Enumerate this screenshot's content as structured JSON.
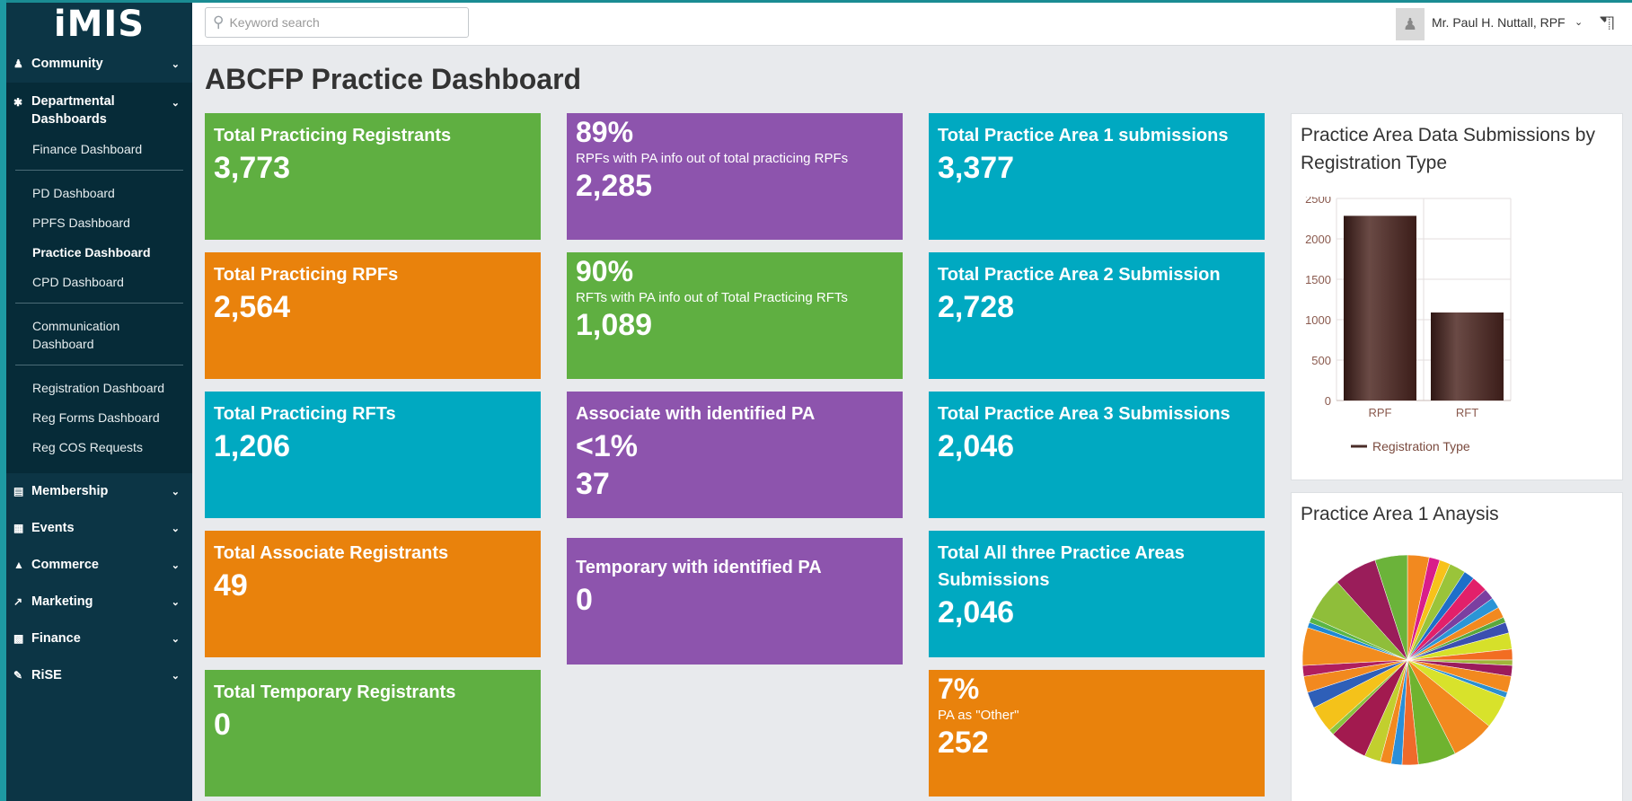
{
  "app": {
    "logo": "iMIS"
  },
  "header": {
    "search_placeholder": "Keyword search",
    "user_name": "Mr. Paul H. Nuttall, RPF",
    "icons": {
      "search": "magnifier-icon",
      "user": "person-icon",
      "cart": "cart-icon"
    }
  },
  "sidebar": {
    "community": "Community",
    "departmental": "Departmental Dashboards",
    "sub_items": [
      "Finance Dashboard",
      "PD Dashboard",
      "PPFS Dashboard",
      "Practice Dashboard",
      "CPD Dashboard",
      "Communication Dashboard",
      "Registration Dashboard",
      "Reg Forms Dashboard",
      "Reg COS Requests"
    ],
    "active_item": "Practice Dashboard",
    "groups": [
      "Membership",
      "Events",
      "Commerce",
      "Marketing",
      "Finance",
      "RiSE"
    ]
  },
  "page": {
    "title": "ABCFP Practice Dashboard"
  },
  "cards": {
    "c1": {
      "title": "Total Practicing Registrants",
      "value": "3,773"
    },
    "c2": {
      "title": "Total Practicing RPFs",
      "value": "2,564"
    },
    "c3": {
      "title": "Total Practicing RFTs",
      "value": "1,206"
    },
    "c4": {
      "title": "Total Associate Registrants",
      "value": "49"
    },
    "c5": {
      "title": "Total Temporary Registrants",
      "value": "0"
    },
    "p1": {
      "pct": "89%",
      "desc": "RPFs with PA info out of total practicing RPFs",
      "value": "2,285"
    },
    "p2": {
      "pct": "90%",
      "desc": "RFTs with PA info out of Total Practicing RFTs",
      "value": "1,089"
    },
    "p3": {
      "title": "Associate with identified PA",
      "pct": "<1%",
      "value": "37"
    },
    "p4": {
      "title": "Temporary with identified PA",
      "value": "0"
    },
    "t1": {
      "title": "Total Practice Area 1 submissions",
      "value": "3,377"
    },
    "t2": {
      "title": "Total Practice Area 2 Submission",
      "value": "2,728"
    },
    "t3": {
      "title": "Total Practice Area 3 Submissions",
      "value": "2,046"
    },
    "t4": {
      "title": "Total All three Practice Areas Submissions",
      "value": "2,046"
    },
    "t5": {
      "pct": "7%",
      "desc": "PA as \"Other\"",
      "value": "252"
    }
  },
  "colors": {
    "green": "#5faf41",
    "orange": "#e9820c",
    "teal": "#00a9c1",
    "purple": "#8d54ad",
    "sidebar": "#0c3545",
    "bar": "#4a2c28"
  },
  "panels": {
    "bar_title": "Practice Area Data Submissions by Registration Type",
    "pie_title": "Practice Area 1 Anaysis"
  },
  "chart_data": [
    {
      "type": "bar",
      "title": "Practice Area Data Submissions by Registration Type",
      "categories": [
        "RPF",
        "RFT"
      ],
      "series": [
        {
          "name": "Registration Type",
          "values": [
            2285,
            1089
          ]
        }
      ],
      "ylim": [
        0,
        2500
      ],
      "yticks": [
        "0",
        "500",
        "1000",
        "1500",
        "2000",
        "2500"
      ],
      "grid": true,
      "legend": "bottom"
    },
    {
      "type": "pie",
      "title": "Practice Area 1 Anaysis",
      "values": [
        4,
        2,
        2,
        3,
        2,
        3,
        2,
        2,
        2,
        1,
        2,
        3,
        2,
        1,
        2,
        3,
        1,
        6,
        8,
        7,
        3,
        2,
        2,
        3,
        7,
        1,
        5,
        3,
        3,
        2,
        7,
        1,
        1,
        8,
        8,
        6
      ],
      "colors": [
        "#f2891f",
        "#d91d8a",
        "#f7c21a",
        "#9ac43a",
        "#1e6fc9",
        "#e2206a",
        "#7b3fa0",
        "#2b95d6",
        "#f2891f",
        "#5aa83c",
        "#3a4fb0",
        "#d6e02a",
        "#f26d22",
        "#a0b53a",
        "#9b1b5c",
        "#f2891f",
        "#2c8fd0",
        "#d8e22b",
        "#f2891f",
        "#6fb32f",
        "#ef6a2a",
        "#2a8fd8",
        "#f2891f",
        "#c2cf2e",
        "#a21a4f",
        "#8bc53f",
        "#f4c21a",
        "#2e5fb8",
        "#f2891f",
        "#b01e5e",
        "#f28c1e",
        "#1e88d5",
        "#5ab546",
        "#8fbe3a",
        "#9a1d5a",
        "#6bb33a"
      ]
    }
  ]
}
